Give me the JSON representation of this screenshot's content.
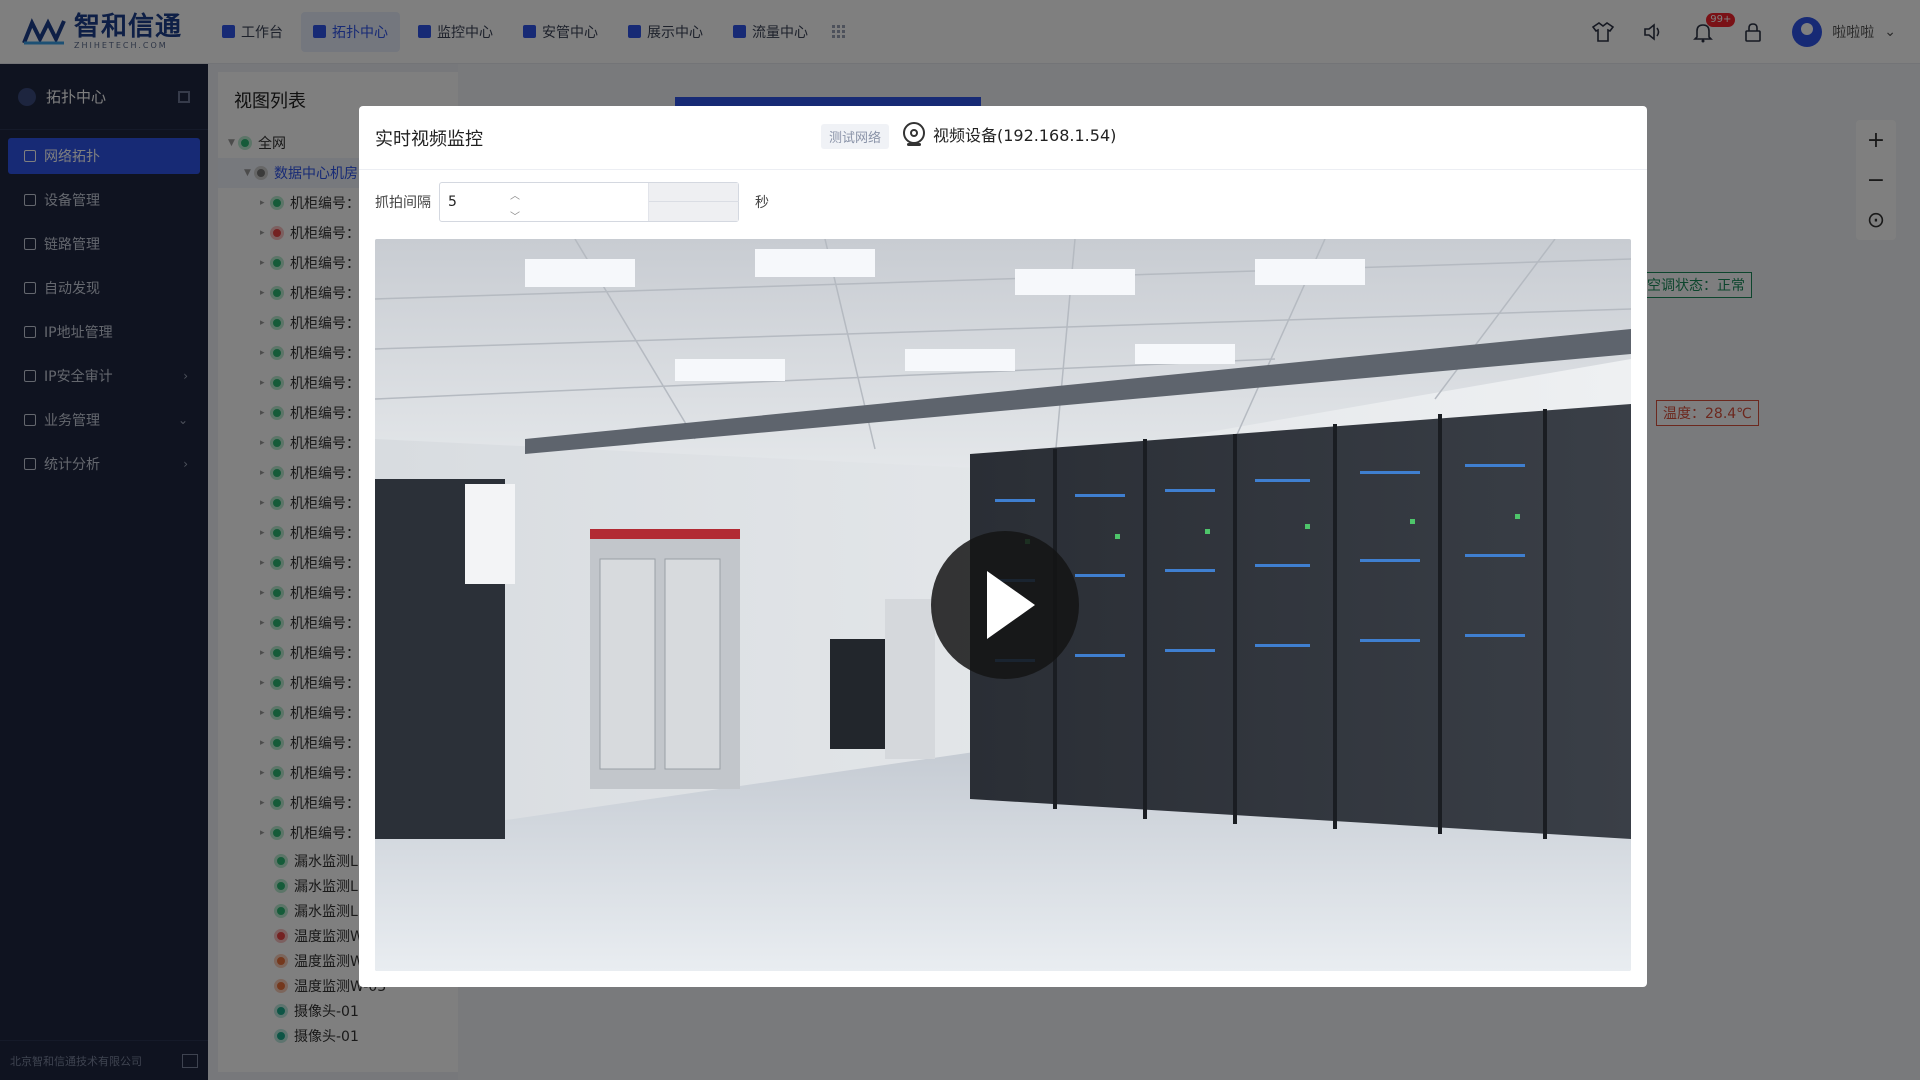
{
  "brand": {
    "name": "智和信通",
    "sub": "ZHIHETECH.COM"
  },
  "nav": {
    "items": [
      {
        "label": "工作台",
        "active": false
      },
      {
        "label": "拓扑中心",
        "active": true
      },
      {
        "label": "监控中心",
        "active": false
      },
      {
        "label": "安管中心",
        "active": false
      },
      {
        "label": "展示中心",
        "active": false
      },
      {
        "label": "流量中心",
        "active": false
      }
    ],
    "notification_badge": "99+",
    "user_name": "啦啦啦"
  },
  "sidebar": {
    "title": "拓扑中心",
    "items": [
      {
        "label": "网络拓扑",
        "active": true,
        "chevron": ""
      },
      {
        "label": "设备管理",
        "active": false,
        "chevron": ""
      },
      {
        "label": "链路管理",
        "active": false,
        "chevron": ""
      },
      {
        "label": "自动发现",
        "active": false,
        "chevron": ""
      },
      {
        "label": "IP地址管理",
        "active": false,
        "chevron": ""
      },
      {
        "label": "IP安全审计",
        "active": false,
        "chevron": "›"
      },
      {
        "label": "业务管理",
        "active": false,
        "chevron": "⌄"
      },
      {
        "label": "统计分析",
        "active": false,
        "chevron": "›"
      }
    ],
    "footer": "北京智和信通技术有限公司"
  },
  "viewlist": {
    "title": "视图列表",
    "root": "全网",
    "node": "数据中心机房",
    "cabinet_label": "机柜编号：",
    "leaf_items": [
      {
        "label": "漏水监测L",
        "dot": "water"
      },
      {
        "label": "漏水监测L",
        "dot": "water"
      },
      {
        "label": "漏水监测L",
        "dot": "water"
      },
      {
        "label": "温度监测W",
        "dot": "red"
      },
      {
        "label": "温度监测W",
        "dot": "orange"
      },
      {
        "label": "温度监测W-03",
        "dot": "orange"
      },
      {
        "label": "摄像头-01",
        "dot": "teal"
      },
      {
        "label": "摄像头-01",
        "dot": "teal"
      }
    ]
  },
  "background_labels": {
    "ac_status": "空调状态：正常",
    "temperature": "温度：28.4℃"
  },
  "modal": {
    "title": "实时视频监控",
    "network_tag": "测试网络",
    "device_title": "视频设备(192.168.1.54)",
    "interval_label": "抓拍间隔",
    "interval_value": "5",
    "interval_unit": "秒"
  },
  "colors": {
    "accent": "#2f54eb",
    "sidebar_bg": "#1e2640",
    "status_green": "#2bb673",
    "status_red": "#e84545"
  }
}
